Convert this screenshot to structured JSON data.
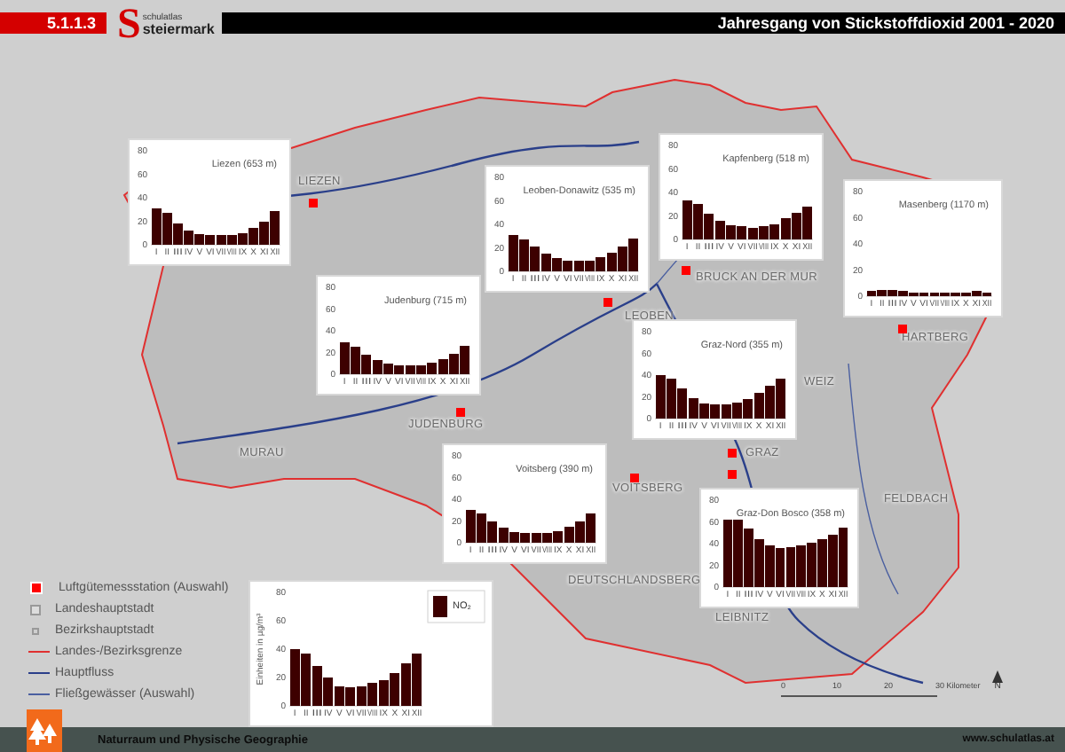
{
  "header": {
    "section": "5.1.1.3",
    "logo": {
      "letter": "S",
      "line1": "schulatlas",
      "line2": "steiermark"
    },
    "title": "Jahresgang von Stickstoffdioxid 2001 - 2020"
  },
  "cities": [
    {
      "name": "LIEZEN"
    },
    {
      "name": "BRUCK AN DER MUR"
    },
    {
      "name": "LEOBEN"
    },
    {
      "name": "HARTBERG"
    },
    {
      "name": "WEIZ"
    },
    {
      "name": "JUDENBURG"
    },
    {
      "name": "MURAU"
    },
    {
      "name": "GRAZ"
    },
    {
      "name": "VOITSBERG"
    },
    {
      "name": "FELDBACH"
    },
    {
      "name": "DEUTSCHLANDSBERG"
    },
    {
      "name": "LEIBNITZ"
    }
  ],
  "stations": [
    {
      "chart_data": {
        "type": "bar",
        "title": "Kapfenberg (518 m)",
        "categories": [
          "I",
          "II",
          "III",
          "IV",
          "V",
          "VI",
          "VII",
          "VIII",
          "IX",
          "X",
          "XI",
          "XII"
        ],
        "values": [
          33,
          30,
          22,
          16,
          12,
          11,
          10,
          11,
          13,
          18,
          23,
          28
        ],
        "ylim": [
          0,
          80
        ],
        "yticks": [
          0,
          20,
          40,
          60,
          80
        ]
      }
    },
    {
      "chart_data": {
        "type": "bar",
        "title": "Liezen (653 m)",
        "categories": [
          "I",
          "II",
          "III",
          "IV",
          "V",
          "VI",
          "VII",
          "VIII",
          "IX",
          "X",
          "XI",
          "XII"
        ],
        "values": [
          31,
          27,
          18,
          12,
          9,
          8,
          8,
          8,
          10,
          14,
          20,
          29
        ],
        "ylim": [
          0,
          80
        ],
        "yticks": [
          0,
          20,
          40,
          60,
          80
        ]
      }
    },
    {
      "chart_data": {
        "type": "bar",
        "title": "Leoben-Donawitz (535 m)",
        "categories": [
          "I",
          "II",
          "III",
          "IV",
          "V",
          "VI",
          "VII",
          "VIII",
          "IX",
          "X",
          "XI",
          "XII"
        ],
        "values": [
          31,
          27,
          21,
          15,
          11,
          9,
          9,
          9,
          12,
          16,
          21,
          28
        ],
        "ylim": [
          0,
          80
        ],
        "yticks": [
          0,
          20,
          40,
          60,
          80
        ]
      }
    },
    {
      "chart_data": {
        "type": "bar",
        "title": "Masenberg (1170 m)",
        "categories": [
          "I",
          "II",
          "III",
          "IV",
          "V",
          "VI",
          "VII",
          "VIII",
          "IX",
          "X",
          "XI",
          "XII"
        ],
        "values": [
          4,
          5,
          5,
          4,
          3,
          3,
          3,
          3,
          3,
          3,
          4,
          3
        ],
        "ylim": [
          0,
          80
        ],
        "yticks": [
          0,
          20,
          40,
          60,
          80
        ]
      }
    },
    {
      "chart_data": {
        "type": "bar",
        "title": "Judenburg (715 m)",
        "categories": [
          "I",
          "II",
          "III",
          "IV",
          "V",
          "VI",
          "VII",
          "VIII",
          "IX",
          "X",
          "XI",
          "XII"
        ],
        "values": [
          29,
          25,
          18,
          13,
          10,
          8,
          8,
          8,
          11,
          14,
          19,
          26
        ],
        "ylim": [
          0,
          80
        ],
        "yticks": [
          0,
          20,
          40,
          60,
          80
        ]
      }
    },
    {
      "chart_data": {
        "type": "bar",
        "title": "Graz-Nord (355 m)",
        "categories": [
          "I",
          "II",
          "III",
          "IV",
          "V",
          "VI",
          "VII",
          "VIII",
          "IX",
          "X",
          "XI",
          "XII"
        ],
        "values": [
          40,
          37,
          28,
          19,
          14,
          13,
          13,
          15,
          18,
          24,
          30,
          37
        ],
        "ylim": [
          0,
          80
        ],
        "yticks": [
          0,
          20,
          40,
          60,
          80
        ]
      }
    },
    {
      "chart_data": {
        "type": "bar",
        "title": "Voitsberg (390 m)",
        "categories": [
          "I",
          "II",
          "III",
          "IV",
          "V",
          "VI",
          "VII",
          "VIII",
          "IX",
          "X",
          "XI",
          "XII"
        ],
        "values": [
          30,
          27,
          20,
          14,
          10,
          9,
          9,
          9,
          11,
          15,
          20,
          27
        ],
        "ylim": [
          0,
          80
        ],
        "yticks": [
          0,
          20,
          40,
          60,
          80
        ]
      }
    },
    {
      "chart_data": {
        "type": "bar",
        "title": "Graz-Don Bosco (358 m)",
        "categories": [
          "I",
          "II",
          "III",
          "IV",
          "V",
          "VI",
          "VII",
          "VIII",
          "IX",
          "X",
          "XI",
          "XII"
        ],
        "values": [
          62,
          62,
          54,
          44,
          38,
          36,
          37,
          38,
          41,
          44,
          48,
          55
        ],
        "ylim": [
          0,
          80
        ],
        "yticks": [
          0,
          20,
          40,
          60,
          80
        ]
      }
    }
  ],
  "legend": {
    "items": [
      {
        "kind": "station",
        "label": "Luftgütemessstation (Auswahl)"
      },
      {
        "kind": "capital",
        "label": "Landeshauptstadt"
      },
      {
        "kind": "district",
        "label": "Bezirkshauptstadt"
      },
      {
        "kind": "border",
        "label": "Landes-/Bezirksgrenze"
      },
      {
        "kind": "main-river",
        "label": "Hauptfluss"
      },
      {
        "kind": "river",
        "label": "Fließgewässer (Auswahl)"
      }
    ],
    "chart_data": {
      "type": "bar",
      "ylabel": "Einheiten in µg/m³",
      "categories": [
        "I",
        "II",
        "III",
        "IV",
        "V",
        "VI",
        "VII",
        "VIII",
        "IX",
        "X",
        "XI",
        "XII"
      ],
      "series": [
        {
          "name": "NO₂",
          "color": "#3d0000",
          "values": [
            40,
            37,
            28,
            20,
            14,
            13,
            14,
            16,
            18,
            23,
            30,
            37
          ]
        }
      ],
      "ylim": [
        0,
        80
      ],
      "yticks": [
        0,
        20,
        40,
        60,
        80
      ]
    }
  },
  "scale": {
    "ticks": [
      "0",
      "10",
      "20",
      "30 Kilometer"
    ],
    "north": "N"
  },
  "footer": {
    "topic": "Naturraum und Physische Geographie",
    "url": "www.schulatlas.at"
  }
}
